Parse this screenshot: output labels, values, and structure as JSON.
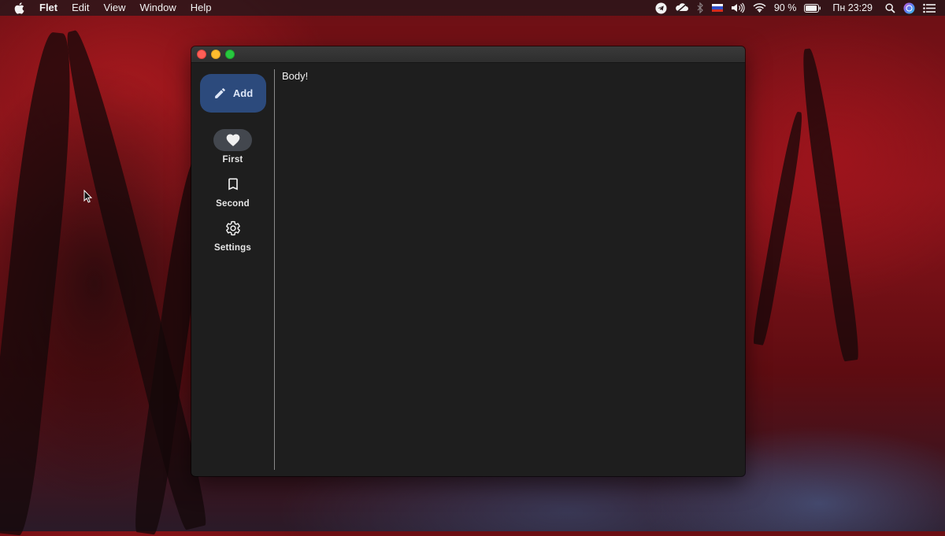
{
  "menubar": {
    "app_name": "Flet",
    "items": [
      "Edit",
      "View",
      "Window",
      "Help"
    ],
    "battery_percent": "90 %",
    "clock": "Пн 23:29",
    "icons": [
      "apple-icon",
      "telegram-icon",
      "cloud-icon",
      "bluetooth-icon",
      "russian-flag-icon",
      "volume-icon",
      "wifi-icon",
      "battery-icon",
      "spotlight-icon",
      "siri-icon",
      "notification-center-icon"
    ]
  },
  "window": {
    "rail": {
      "fab_label": "Add",
      "fab_icon": "pencil-icon",
      "destinations": [
        {
          "label": "First",
          "icon": "heart-icon",
          "selected": true
        },
        {
          "label": "Second",
          "icon": "bookmark-icon",
          "selected": false
        },
        {
          "label": "Settings",
          "icon": "gear-icon",
          "selected": false
        }
      ]
    },
    "body_text": "Body!"
  },
  "colors": {
    "window_bg": "#1e1e1e",
    "fab_bg": "#2c4a7c",
    "indicator_bg": "#43474e",
    "close": "#fe5f57",
    "minimize": "#febc2e",
    "maximize": "#28c840"
  }
}
